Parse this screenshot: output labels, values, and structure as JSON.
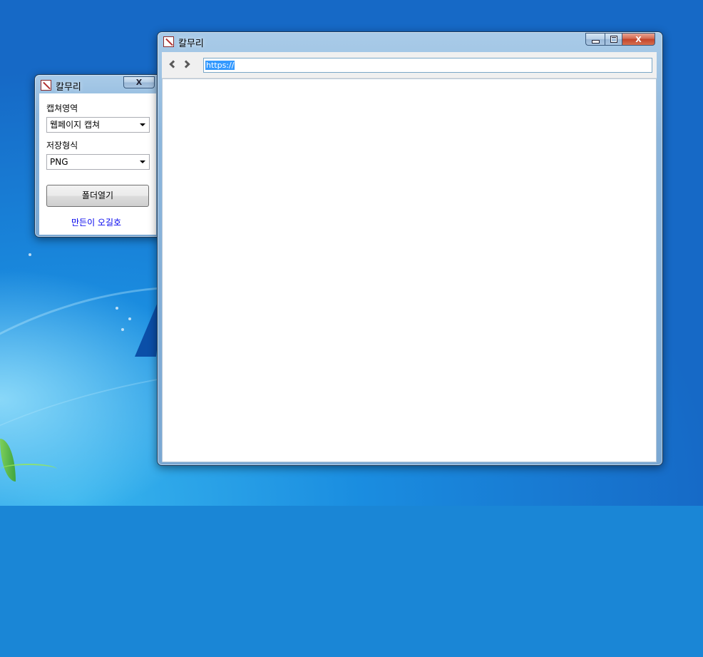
{
  "small_window": {
    "title": "칼무리",
    "capture_area_label": "캡쳐영역",
    "capture_area_value": "웹페이지 캡쳐",
    "save_format_label": "저장형식",
    "save_format_value": "PNG",
    "open_folder_button": "폴더열기",
    "author_link": "만든이 오길호",
    "close_glyph": "X"
  },
  "main_window": {
    "title": "칼무리",
    "url_value": "https://",
    "close_glyph": "X"
  },
  "colors": {
    "link": "#0000ee",
    "selection": "#3399ff",
    "close_button": "#c2432a"
  }
}
